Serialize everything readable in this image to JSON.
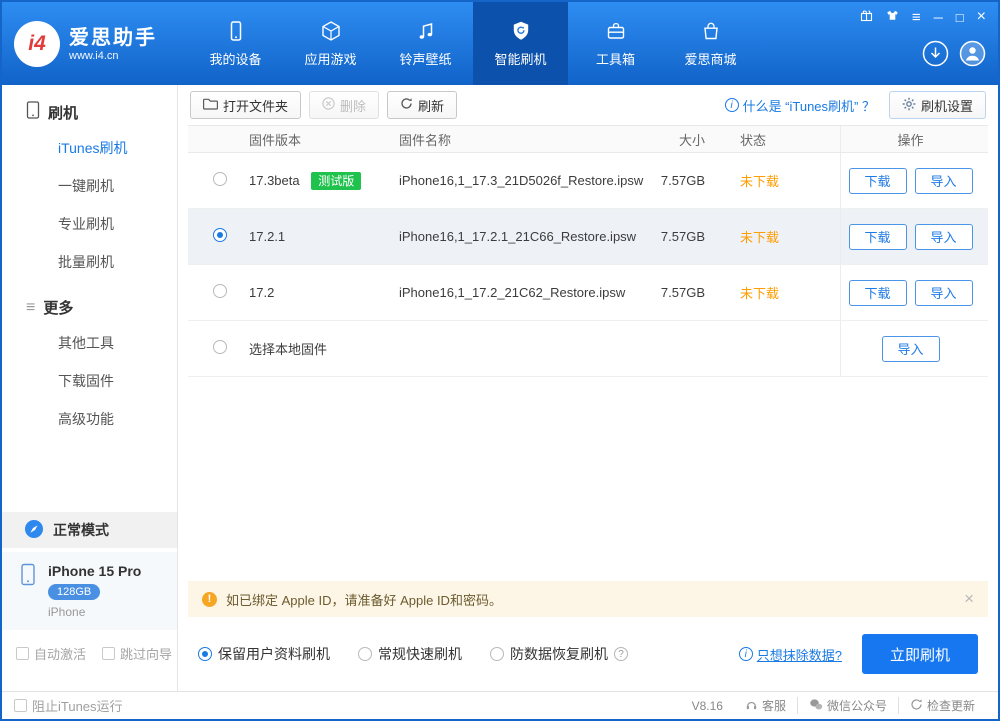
{
  "colors": {
    "accent": "#1a7ae4",
    "status_orange": "#ff9c00",
    "badge_green": "#1fc24d"
  },
  "app": {
    "name": "爱思助手",
    "site": "www.i4.cn",
    "logo_text": "i4"
  },
  "header": {
    "nav": [
      {
        "label": "我的设备"
      },
      {
        "label": "应用游戏"
      },
      {
        "label": "铃声壁纸"
      },
      {
        "label": "智能刷机"
      },
      {
        "label": "工具箱"
      },
      {
        "label": "爱思商城"
      }
    ],
    "window_icons": {
      "menu": "≡",
      "minimize": "─",
      "maximize": "□",
      "close": "×"
    }
  },
  "icons": {
    "info": "i",
    "question": "?",
    "warn": "!"
  },
  "sidebar": {
    "sections": [
      {
        "title": "刷机",
        "items": [
          {
            "label": "iTunes刷机"
          },
          {
            "label": "一键刷机"
          },
          {
            "label": "专业刷机"
          },
          {
            "label": "批量刷机"
          }
        ]
      },
      {
        "title": "更多",
        "items": [
          {
            "label": "其他工具"
          },
          {
            "label": "下载固件"
          },
          {
            "label": "高级功能"
          }
        ]
      }
    ],
    "mode_label": "正常模式",
    "device": {
      "name": "iPhone 15 Pro",
      "capacity": "128GB",
      "type": "iPhone"
    },
    "options": [
      {
        "label": "自动激活"
      },
      {
        "label": "跳过向导"
      }
    ]
  },
  "toolbar": {
    "open_folder": "打开文件夹",
    "delete": "删除",
    "refresh": "刷新",
    "help_link": "什么是 “iTunes刷机” ？",
    "settings": "刷机设置"
  },
  "table": {
    "headers": [
      "固件版本",
      "固件名称",
      "大小",
      "状态",
      "操作"
    ],
    "rows": [
      {
        "version": "17.3beta",
        "badge": "测试版",
        "name": "iPhone16,1_17.3_21D5026f_Restore.ipsw",
        "size": "7.57GB",
        "status": "未下载",
        "actions": [
          "下载",
          "导入"
        ]
      },
      {
        "version": "17.2.1",
        "name": "iPhone16,1_17.2.1_21C66_Restore.ipsw",
        "size": "7.57GB",
        "status": "未下载",
        "actions": [
          "下载",
          "导入"
        ],
        "selected": true
      },
      {
        "version": "17.2",
        "name": "iPhone16,1_17.2_21C62_Restore.ipsw",
        "size": "7.57GB",
        "status": "未下载",
        "actions": [
          "下载",
          "导入"
        ]
      },
      {
        "version": "选择本地固件",
        "actions": [
          "导入"
        ]
      }
    ]
  },
  "warning": {
    "text": "如已绑定 Apple ID，请准备好 Apple ID和密码。"
  },
  "flash": {
    "modes": [
      {
        "label": "保留用户资料刷机",
        "selected": true
      },
      {
        "label": "常规快速刷机"
      },
      {
        "label": "防数据恢复刷机"
      }
    ],
    "erase_link": "只想抹除数据?",
    "flash_button": "立即刷机"
  },
  "statusbar": {
    "block_itunes": "阻止iTunes运行",
    "version": "V8.16",
    "support": "客服",
    "wechat": "微信公众号",
    "check_update": "检查更新"
  }
}
